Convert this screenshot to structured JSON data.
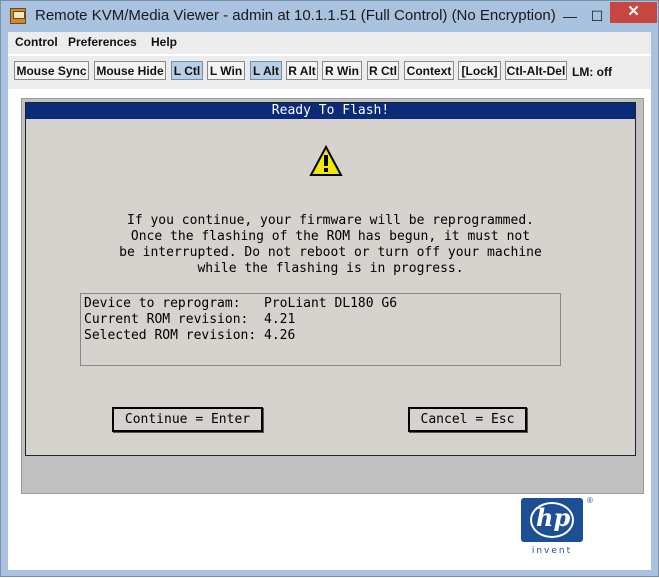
{
  "window": {
    "title": "Remote KVM/Media Viewer - admin at 10.1.1.51 (Full Control) (No Encryption)",
    "minimize_glyph": "—",
    "maximize_glyph": "☐",
    "close_glyph": "✕"
  },
  "menu": {
    "items": [
      "Control",
      "Preferences",
      "Help"
    ]
  },
  "toolbar": {
    "buttons": [
      "Mouse Sync",
      "Mouse Hide",
      "L Ctl",
      "L Win",
      "L Alt",
      "R Alt",
      "R Win",
      "R Ctl",
      "Context",
      "[Lock]",
      "Ctl-Alt-Del"
    ],
    "active": [
      "L Ctl",
      "L Alt"
    ],
    "status": "LM: off"
  },
  "dialog": {
    "title": "Ready To Flash!",
    "message_lines": [
      "If you continue, your firmware will be reprogrammed.",
      "Once the flashing of the ROM has begun, it must not",
      "be interrupted. Do not reboot or turn off your machine",
      "while the flashing is in progress."
    ],
    "info": [
      "Device to reprogram:   ProLiant DL180 G6",
      "Current ROM revision:  4.21",
      "Selected ROM revision: 4.26"
    ],
    "continue_label": "Continue = Enter",
    "cancel_label": "Cancel = Esc"
  },
  "logo": {
    "brand": "hp",
    "tagline": "invent",
    "registered": "®"
  },
  "colors": {
    "dialog_title_bg": "#0a2a7a",
    "dialog_bg": "#d6d3ce",
    "warning": "#f5e800",
    "brand": "#1d4f96"
  }
}
